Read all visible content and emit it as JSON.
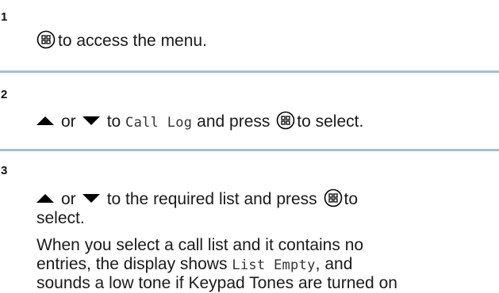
{
  "steps": [
    {
      "number": "1",
      "line1": "to access the menu."
    },
    {
      "number": "2",
      "or_word": "or",
      "to_word": "to",
      "menu_item": "Call Log",
      "and_press": "and press",
      "tail": "to select."
    },
    {
      "number": "3",
      "or_word": "or",
      "mid_text": "to the required list and press",
      "tail": "to",
      "line2": "select.",
      "note_line1": "When you select a call list and it contains no",
      "note_line2_pre": "entries, the display shows",
      "note_line2_mono": "List Empty",
      "note_line2_post": ", and",
      "note_line3": "sounds a low tone if Keypad Tones are turned on"
    }
  ],
  "icons": {
    "menu_ok": "menu-ok-button-icon",
    "up": "up-arrow-icon",
    "down": "down-arrow-icon"
  },
  "colors": {
    "divider": "#a6bfd2",
    "text": "#1a1a1a"
  }
}
